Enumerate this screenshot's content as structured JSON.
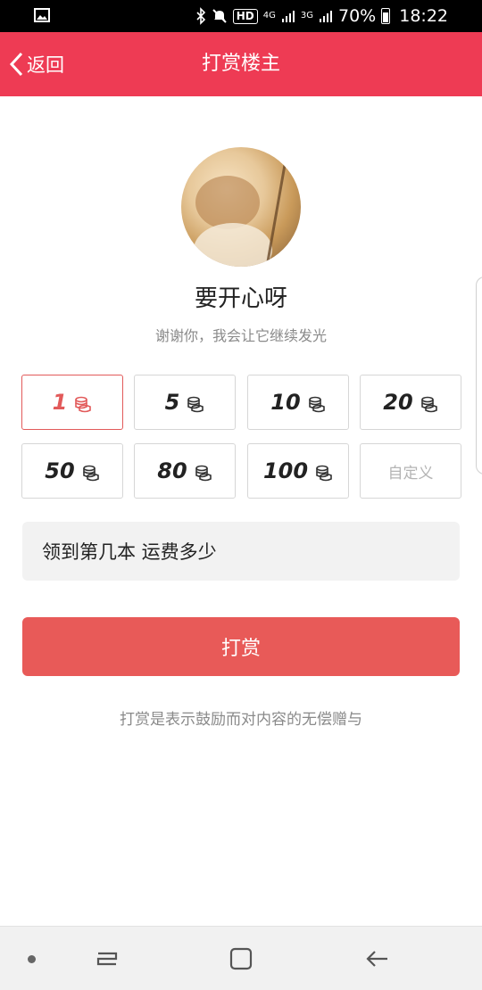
{
  "status_bar": {
    "hd": "HD",
    "net1": "4G",
    "net2": "3G",
    "battery": "70%",
    "time": "18:22"
  },
  "header": {
    "back_label": "返回",
    "title": "打赏楼主"
  },
  "user": {
    "name": "要开心呀",
    "thanks": "谢谢你，我会让它继续发光"
  },
  "amounts": [
    "1",
    "5",
    "10",
    "20",
    "50",
    "80",
    "100"
  ],
  "custom_label": "自定义",
  "message": "领到第几本 运费多少",
  "reward_button": "打赏",
  "disclaimer": "打赏是表示鼓励而对内容的无偿赠与",
  "colors": {
    "header": "#ee3b54",
    "button": "#e85a58",
    "selected": "#e25a5a"
  }
}
